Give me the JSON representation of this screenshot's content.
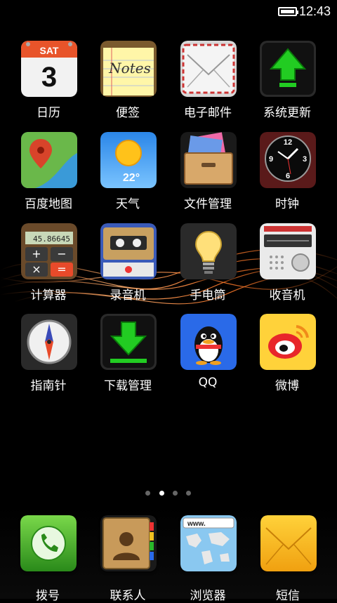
{
  "status_bar": {
    "time": "12:43"
  },
  "home": {
    "apps": [
      {
        "label": "日历",
        "icon": "calendar-icon",
        "day_name": "SAT",
        "day_number": "3"
      },
      {
        "label": "便签",
        "icon": "notes-icon",
        "notes_text": "Notes"
      },
      {
        "label": "电子邮件",
        "icon": "envelope-icon"
      },
      {
        "label": "系统更新",
        "icon": "update-arrow-icon"
      },
      {
        "label": "百度地图",
        "icon": "map-pin-icon"
      },
      {
        "label": "天气",
        "icon": "weather-sun-icon",
        "temperature": "22°"
      },
      {
        "label": "文件管理",
        "icon": "file-drawer-icon"
      },
      {
        "label": "时钟",
        "icon": "clock-icon"
      },
      {
        "label": "计算器",
        "icon": "calculator-icon",
        "display": "45.86645"
      },
      {
        "label": "录音机",
        "icon": "cassette-icon"
      },
      {
        "label": "手电筒",
        "icon": "light-bulb-icon"
      },
      {
        "label": "收音机",
        "icon": "radio-icon"
      },
      {
        "label": "指南针",
        "icon": "compass-icon"
      },
      {
        "label": "下载管理",
        "icon": "download-arrow-icon"
      },
      {
        "label": "QQ",
        "icon": "qq-penguin-icon"
      },
      {
        "label": "微博",
        "icon": "weibo-icon"
      }
    ]
  },
  "pager": {
    "pages": 4,
    "current": 2
  },
  "dock": {
    "apps": [
      {
        "label": "拨号",
        "icon": "phone-icon"
      },
      {
        "label": "联系人",
        "icon": "contacts-book-icon"
      },
      {
        "label": "浏览器",
        "icon": "browser-world-map-icon",
        "url_text": "www."
      },
      {
        "label": "短信",
        "icon": "sms-envelope-icon"
      }
    ]
  },
  "colors": {
    "background": "#000000",
    "text": "#ffffff",
    "wave": "#ff7a2a"
  }
}
